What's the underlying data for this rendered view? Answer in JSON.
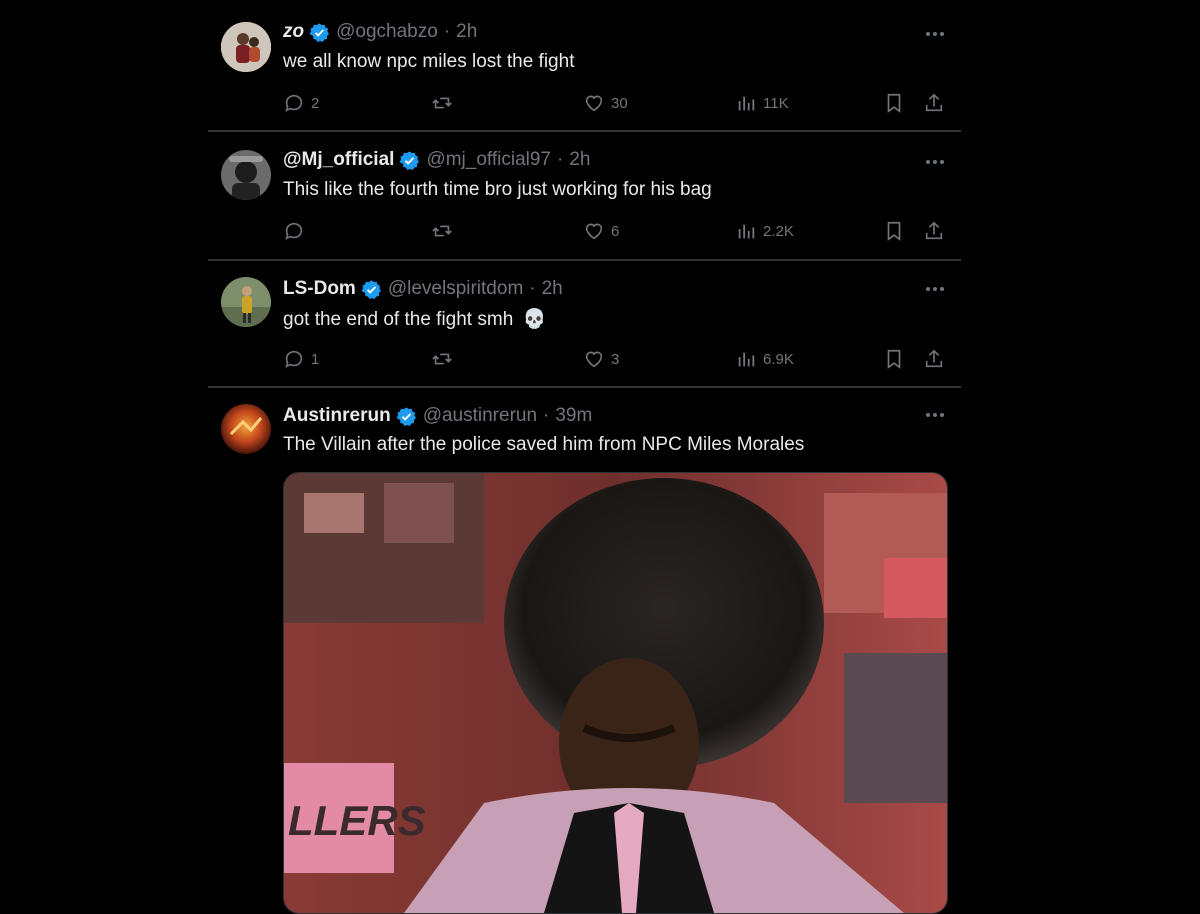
{
  "colors": {
    "background": "#000000",
    "text": "#e7e9ea",
    "muted": "#71767b",
    "verified": "#1d9bf0",
    "divider": "#2f3336"
  },
  "tweets": [
    {
      "name": "zo",
      "handle": "@ogchabzo",
      "time": "2h",
      "text": "we all know npc miles lost the fight",
      "replies": "2",
      "retweets": "",
      "likes": "30",
      "views": "11K"
    },
    {
      "name": "@Mj_official",
      "handle": "@mj_official97",
      "time": "2h",
      "text": "This like the fourth time bro just working for his bag",
      "replies": "",
      "retweets": "",
      "likes": "6",
      "views": "2.2K"
    },
    {
      "name": "LS-Dom",
      "handle": "@levelspiritdom",
      "time": "2h",
      "text": "got the end of the fight smh",
      "emoji": "💀",
      "replies": "1",
      "retweets": "",
      "likes": "3",
      "views": "6.9K"
    },
    {
      "name": "Austinrerun",
      "handle": "@austinrerun",
      "time": "39m",
      "text": "The Villain after the police saved him from NPC Miles Morales"
    }
  ],
  "media_banner_text": "LLERS",
  "dot": "·",
  "icons": {
    "more": "more-dots-icon",
    "reply": "reply-icon",
    "retweet": "retweet-icon",
    "like": "heart-icon",
    "views": "views-chart-icon",
    "bookmark": "bookmark-icon",
    "share": "share-icon",
    "verified": "verified-badge-icon"
  }
}
